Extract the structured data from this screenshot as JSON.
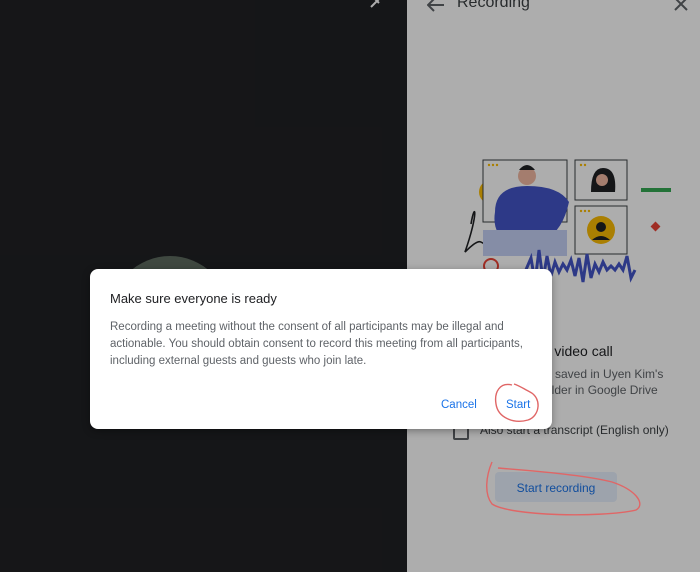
{
  "side_panel": {
    "title": "Recording",
    "heading": "ur video call",
    "description": "e saved in Uyen Kim's older in Google Drive",
    "transcript_label": "Also start a transcript (English only)",
    "transcript_checked": false,
    "start_recording_label": "Start recording"
  },
  "dialog": {
    "title": "Make sure everyone is ready",
    "body": "Recording a meeting without the consent of all participants may be illegal and actionable. You should obtain consent to record this meeting from all participants, including external guests and guests who join late.",
    "cancel_label": "Cancel",
    "start_label": "Start"
  },
  "colors": {
    "accent": "#1a73e8",
    "annotation": "#e06666"
  }
}
